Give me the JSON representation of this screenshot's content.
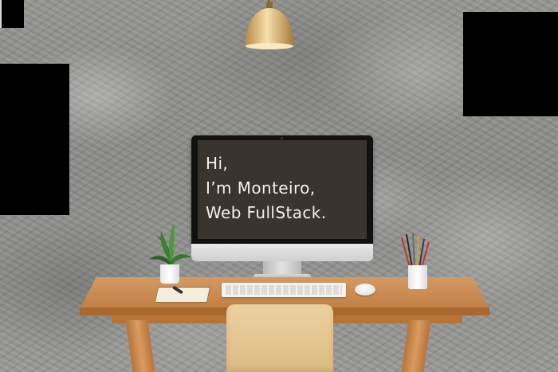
{
  "hero": {
    "line1": "Hi,",
    "line2": "I’m Monteiro,",
    "line3": "Web FullStack."
  },
  "colors": {
    "wall": "#8d8d8b",
    "screen": "#3a342f",
    "screen_text": "#f4f1ea",
    "desk_wood": "#c98c52",
    "chair_wood": "#e6c792",
    "overlay_block": "#000000"
  },
  "icons": {
    "lamp": "pendant-lamp-icon",
    "plant": "potted-plant-icon",
    "pencils": "pencil-cup-icon"
  }
}
